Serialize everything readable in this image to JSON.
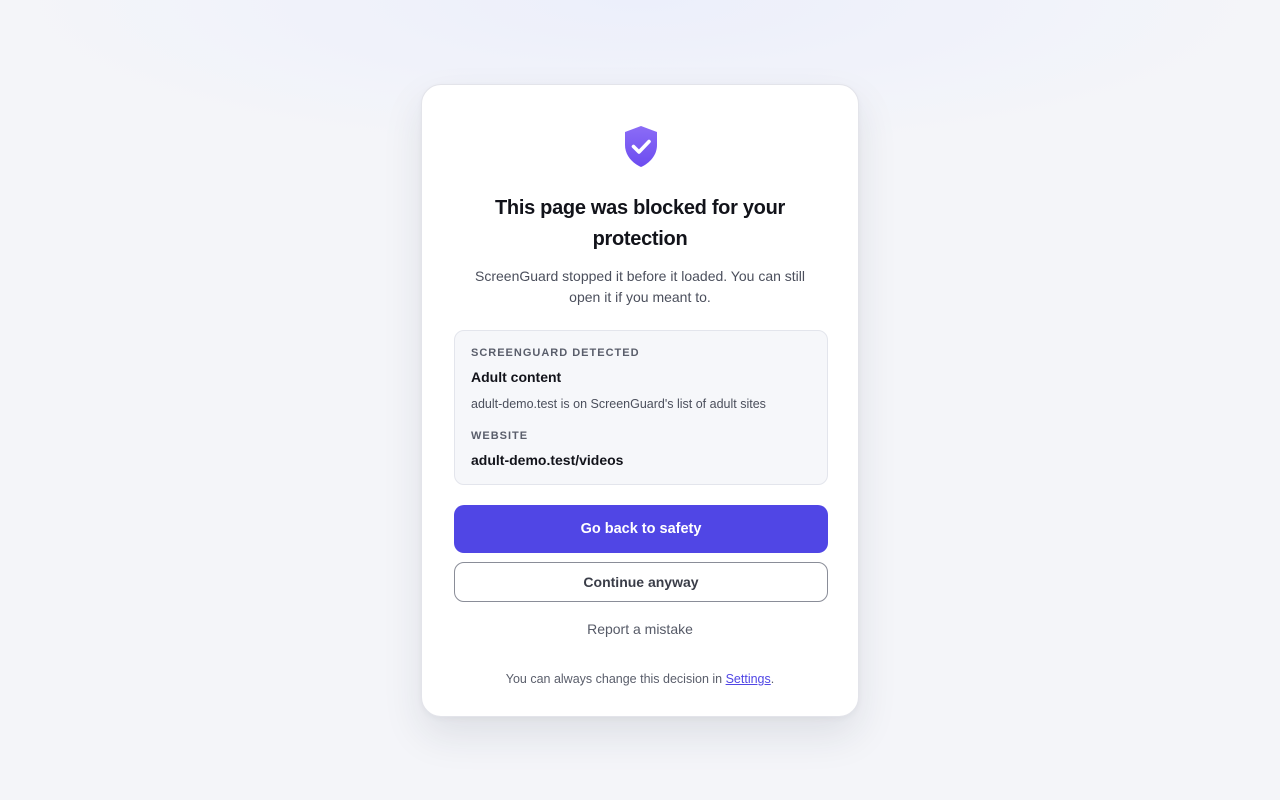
{
  "card": {
    "icon": "shield-check-icon",
    "title": "This page was blocked for your protection",
    "subtitle": "ScreenGuard stopped it before it loaded. You can still open it if you meant to."
  },
  "detection": {
    "label": "SCREENGUARD DETECTED",
    "category": "Adult content",
    "reason": "adult-demo.test is on ScreenGuard's list of adult sites",
    "website_label": "WEBSITE",
    "website": "adult-demo.test/videos"
  },
  "actions": {
    "primary_label": "Go back to safety",
    "secondary_label": "Continue anyway",
    "report_label": "Report a mistake"
  },
  "footer": {
    "text_before": "You can always change this decision in ",
    "link_label": "Settings",
    "text_after": "."
  },
  "colors": {
    "accent": "#5046e5",
    "shield_gradient_top": "#8b6cf6",
    "shield_gradient_bottom": "#6c4cf0"
  }
}
